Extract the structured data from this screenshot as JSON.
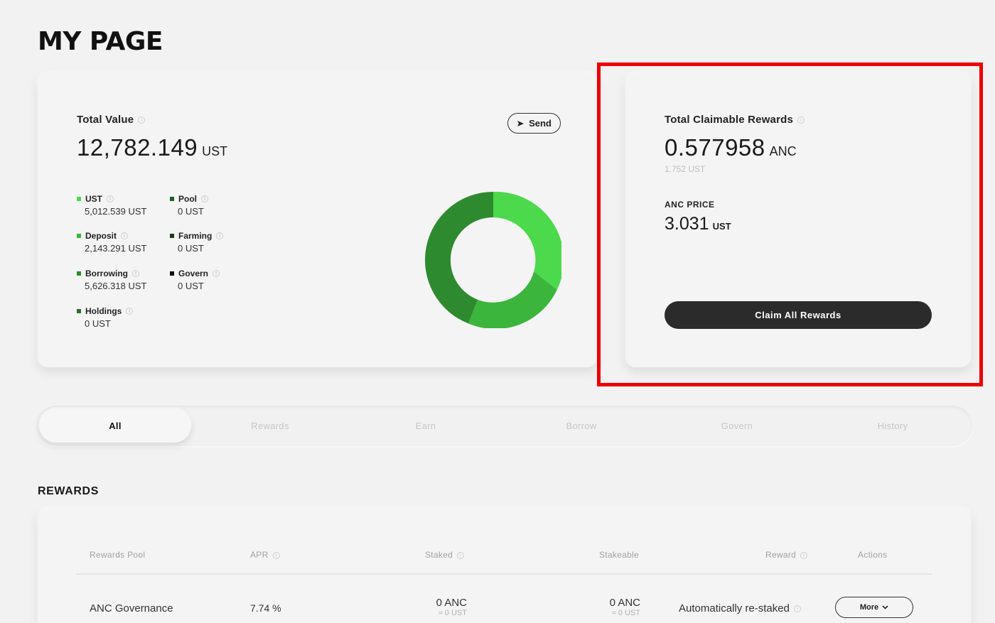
{
  "page_title": "MY PAGE",
  "total": {
    "label": "Total Value",
    "value": "12,782.149",
    "unit": "UST",
    "send_label": "Send",
    "legend": [
      {
        "name": "UST",
        "value": "5,012.539 UST",
        "color": "#4cd94c"
      },
      {
        "name": "Pool",
        "value": "0 UST",
        "color": "#1f5f1f"
      },
      {
        "name": "Deposit",
        "value": "2,143.291 UST",
        "color": "#3cb53c"
      },
      {
        "name": "Farming",
        "value": "0 UST",
        "color": "#163f16"
      },
      {
        "name": "Borrowing",
        "value": "5,626.318 UST",
        "color": "#2e8a2e"
      },
      {
        "name": "Govern",
        "value": "0 UST",
        "color": "#111111"
      },
      {
        "name": "Holdings",
        "value": "0 UST",
        "color": "#2a6e2a"
      }
    ]
  },
  "rewards": {
    "label": "Total Claimable Rewards",
    "value": "0.577958",
    "unit": "ANC",
    "sub_value": "1.752 UST",
    "price_label": "ANC PRICE",
    "price_value": "3.031",
    "price_unit": "UST",
    "claim_label": "Claim All Rewards"
  },
  "tabs": [
    {
      "label": "All",
      "active": true
    },
    {
      "label": "Rewards"
    },
    {
      "label": "Earn"
    },
    {
      "label": "Borrow"
    },
    {
      "label": "Govern"
    },
    {
      "label": "History"
    }
  ],
  "rewards_section": {
    "title": "REWARDS",
    "headers": {
      "pool": "Rewards Pool",
      "apr": "APR",
      "staked": "Staked",
      "stakeable": "Stakeable",
      "reward": "Reward",
      "actions": "Actions"
    },
    "rows": [
      {
        "pool": "ANC Governance",
        "apr": "7.74 %",
        "staked": "0 ANC",
        "staked_sub": "≈ 0 UST",
        "stakeable": "0 ANC",
        "stakeable_sub": "≈ 0 UST",
        "reward": "Automatically re-staked",
        "action_label": "More"
      }
    ]
  },
  "colors": {
    "accent_dark": "#2b2b2b",
    "highlight": "#ee0000",
    "donut": [
      "#4cd94c",
      "#3cb53c",
      "#2e8a2e"
    ]
  }
}
